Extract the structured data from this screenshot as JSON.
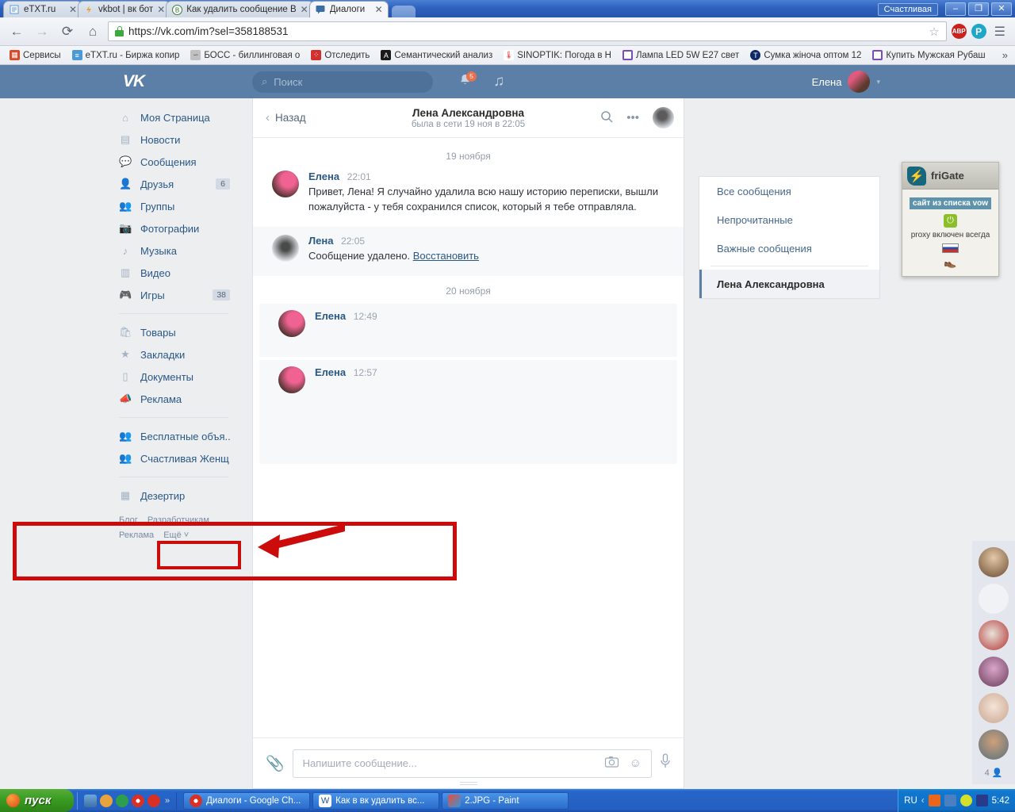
{
  "browser": {
    "tabs": [
      {
        "title": "eTXT.ru",
        "favicon": "document-icon",
        "active": false
      },
      {
        "title": "vkbot | вк бот",
        "favicon": "bolt-icon",
        "active": false
      },
      {
        "title": "Как удалить сообщение В",
        "favicon": "vk-circle-icon",
        "active": false
      },
      {
        "title": "Диалоги",
        "favicon": "chat-icon",
        "active": true
      }
    ],
    "window_tag": "Счастливая",
    "window_buttons": {
      "minimize": "–",
      "maximize": "❐",
      "close": "✕"
    },
    "nav": {
      "back": "←",
      "forward": "→",
      "reload": "⟳",
      "home": "⌂"
    },
    "url": "https://vk.com/im?sel=358188531",
    "url_scheme": "https://",
    "url_rest": "vk.com/im?sel=358188531",
    "toolbar_icons": {
      "bookmark_star": "☆",
      "adblock": "ABP",
      "p_extension": "P",
      "menu": "☰"
    },
    "bookmarks": [
      {
        "label": "Сервисы",
        "icon": "apps-grid-icon",
        "color": "#cc4b37"
      },
      {
        "label": "eTXT.ru - Биржа копир",
        "icon": "document-icon",
        "color": "#3a8fd8"
      },
      {
        "label": "БОСС - биллинговая о",
        "icon": "boss-icon",
        "color": "#9a9a9a"
      },
      {
        "label": "Отследить",
        "icon": "red-square-icon",
        "color": "#d32f2f"
      },
      {
        "label": "Семантический анализ",
        "icon": "letter-a-icon",
        "color": "#1a1a1a"
      },
      {
        "label": "SINOPTIK: Погода в Н",
        "icon": "thermometer-icon",
        "color": "#ffffff"
      },
      {
        "label": "Лампа LED 5W E27 свет",
        "icon": "purple-square-icon",
        "color": "#7b4bbd"
      },
      {
        "label": "Сумка жіноча оптом 12",
        "icon": "letter-t-circle-icon",
        "color": "#0d2a66"
      },
      {
        "label": "Купить Мужская Рубаш",
        "icon": "purple-square-icon",
        "color": "#7b4bbd"
      }
    ],
    "bookmarks_overflow": "»"
  },
  "vk": {
    "logo": "VK",
    "search": {
      "placeholder": "Поиск",
      "icon": "search-icon"
    },
    "header_icons": {
      "bell": "bell-icon",
      "music": "music-note-icon"
    },
    "notification_count": "5",
    "user": {
      "name": "Елена",
      "caret": "▾"
    },
    "sidebar": {
      "items": [
        {
          "label": "Моя Страница",
          "icon": "home-icon",
          "badge": ""
        },
        {
          "label": "Новости",
          "icon": "news-icon",
          "badge": ""
        },
        {
          "label": "Сообщения",
          "icon": "message-icon",
          "badge": ""
        },
        {
          "label": "Друзья",
          "icon": "user-icon",
          "badge": "6"
        },
        {
          "label": "Группы",
          "icon": "users-icon",
          "badge": ""
        },
        {
          "label": "Фотографии",
          "icon": "camera-icon",
          "badge": ""
        },
        {
          "label": "Музыка",
          "icon": "music-note-icon",
          "badge": ""
        },
        {
          "label": "Видео",
          "icon": "film-icon",
          "badge": ""
        },
        {
          "label": "Игры",
          "icon": "gamepad-icon",
          "badge": "38"
        }
      ],
      "items2": [
        {
          "label": "Товары",
          "icon": "bag-icon",
          "badge": ""
        },
        {
          "label": "Закладки",
          "icon": "star-icon",
          "badge": ""
        },
        {
          "label": "Документы",
          "icon": "file-icon",
          "badge": ""
        },
        {
          "label": "Реклама",
          "icon": "megaphone-icon",
          "badge": ""
        }
      ],
      "items3": [
        {
          "label": "Бесплатные объя...",
          "icon": "users-icon",
          "badge": ""
        },
        {
          "label": "Счастливая Женщ...",
          "icon": "users-icon",
          "badge": ""
        }
      ],
      "items4": [
        {
          "label": "Дезертир",
          "icon": "apps-grid-icon",
          "badge": ""
        }
      ],
      "footer": [
        "Блог",
        "Разработчикам",
        "Реклама",
        "Ещё ˅"
      ]
    },
    "chat": {
      "back_label": "Назад",
      "title": "Лена Александровна",
      "subtitle": "была в сети 19 ноя в 22:05",
      "header_icons": {
        "search": "search-icon",
        "more": "ellipsis-icon",
        "avatar": "contact-avatar"
      },
      "day_separator_1": "19 ноября",
      "day_separator_2": "20 ноября",
      "messages": [
        {
          "author": "Елена",
          "time": "22:01",
          "text": "Привет, Лена! Я случайно удалила всю нашу историю переписки, вышли пожалуйста - у тебя сохранился список, который я тебе отправляла.",
          "avatar": "elena-avatar"
        },
        {
          "author": "Лена",
          "time": "22:05",
          "text": "Сообщение удалено.",
          "link": "Восстановить",
          "avatar": "lena-avatar"
        },
        {
          "author": "Елена",
          "time": "12:49",
          "text": "",
          "avatar": "elena-avatar"
        },
        {
          "author": "Елена",
          "time": "12:57",
          "text": "",
          "avatar": "elena-avatar"
        }
      ],
      "composer": {
        "placeholder": "Напишите сообщение...",
        "attach_icon": "paperclip-icon",
        "camera_icon": "camera-icon",
        "emoji_icon": "smiley-icon",
        "mic_icon": "microphone-icon"
      }
    },
    "right_panel": {
      "items": [
        {
          "label": "Все сообщения",
          "selected": false
        },
        {
          "label": "Непрочитанные",
          "selected": false
        },
        {
          "label": "Важные сообщения",
          "selected": false
        }
      ],
      "selected_dialog": "Лена Александровна"
    },
    "online_rail": {
      "count": "4",
      "icon": "user-icon",
      "avatars": [
        "avatar-1",
        "avatar-2",
        "avatar-3",
        "avatar-4",
        "avatar-5",
        "avatar-6"
      ]
    }
  },
  "frigate": {
    "title": "friGate",
    "logo_icon": "bolt-shield-icon",
    "badge": "сайт из списка vow",
    "power_icon": "power-icon",
    "status": "proxy включен всегда",
    "flag": "ru-flag-icon",
    "footer_icon": "boot-icon"
  },
  "annotations": {
    "color": "#cc0b0b",
    "outer_box": "highlight-deleted-message-row",
    "inner_box": "highlight-restore-link",
    "arrow_right": "arrow-pointing-to-restore-link",
    "arrow_left": "arrow-pointing-to-message-block"
  },
  "taskbar": {
    "start_label": "пуск",
    "quick_launch": [
      "desktop-icon",
      "amule-icon",
      "opera-icon",
      "chrome-icon",
      "yandex-icon"
    ],
    "quick_overflow": "»",
    "tasks": [
      {
        "label": "Диалоги - Google Ch...",
        "icon": "chrome-icon",
        "active": true
      },
      {
        "label": "Как в вк удалить вс...",
        "icon": "word-icon",
        "active": false
      },
      {
        "label": "2.JPG - Paint",
        "icon": "paint-icon",
        "active": false
      }
    ],
    "tray": {
      "language": "RU",
      "icons": [
        "chevron-left-icon",
        "java-icon",
        "network-icon",
        "update-icon",
        "shield-icon"
      ],
      "clock": "5:42"
    }
  }
}
